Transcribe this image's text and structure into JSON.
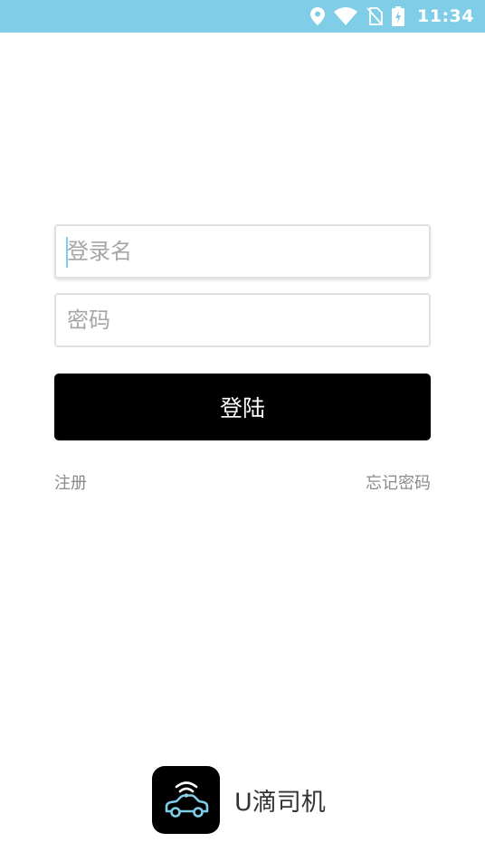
{
  "status_bar": {
    "time": "11:34",
    "background": "#7fcde6",
    "icons": [
      "location-icon",
      "wifi-icon",
      "no-sim-icon",
      "battery-charging-icon"
    ]
  },
  "login": {
    "username": {
      "value": "",
      "placeholder": "登录名"
    },
    "password": {
      "value": "",
      "placeholder": "密码"
    },
    "submit_label": "登陆",
    "register_label": "注册",
    "forgot_label": "忘记密码"
  },
  "brand": {
    "name": "U滴司机",
    "logo_icon": "wifi-car-icon",
    "accent": "#7fcde6"
  }
}
